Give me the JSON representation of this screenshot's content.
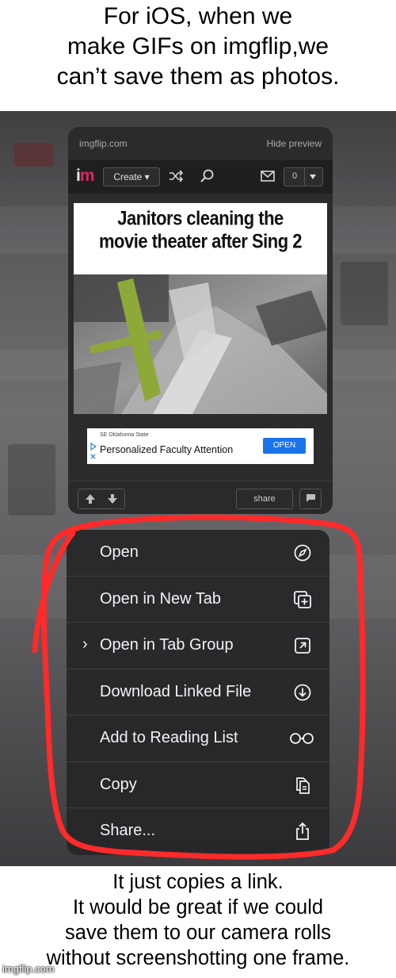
{
  "caption_top": [
    "For iOS, when we",
    "make GIFs on imgflip,we",
    "can’t save them as photos."
  ],
  "caption_bottom": [
    "It just copies a link.",
    "It would be great if we could",
    "save them to our camera rolls",
    "without screenshotting one frame."
  ],
  "preview": {
    "site": "imgflip.com",
    "hide_preview": "Hide preview",
    "logo_i": "i",
    "logo_m": "m",
    "create_label": "Create ▾",
    "notification_count": "0",
    "meme_title": [
      "Janitors cleaning the",
      "movie theater after Sing 2"
    ],
    "ad": {
      "sponsor": "SE Oklahoma State",
      "headline": "Personalized Faculty Attention",
      "button": "OPEN"
    },
    "share_label": "share"
  },
  "context_menu": {
    "items": [
      {
        "label": "Open",
        "icon": "compass-icon",
        "has_chevron": false
      },
      {
        "label": "Open in New Tab",
        "icon": "new-tab-icon",
        "has_chevron": false
      },
      {
        "label": "Open in Tab Group",
        "icon": "tab-group-icon",
        "has_chevron": true
      },
      {
        "label": "Download Linked File",
        "icon": "download-icon",
        "has_chevron": false
      },
      {
        "label": "Add to Reading List",
        "icon": "glasses-icon",
        "has_chevron": false
      },
      {
        "label": "Copy",
        "icon": "copy-icon",
        "has_chevron": false
      },
      {
        "label": "Share...",
        "icon": "share-icon",
        "has_chevron": false
      }
    ],
    "chevron": "›"
  },
  "highlight_color": "#ff2a2a",
  "watermark": "imgflip.com"
}
